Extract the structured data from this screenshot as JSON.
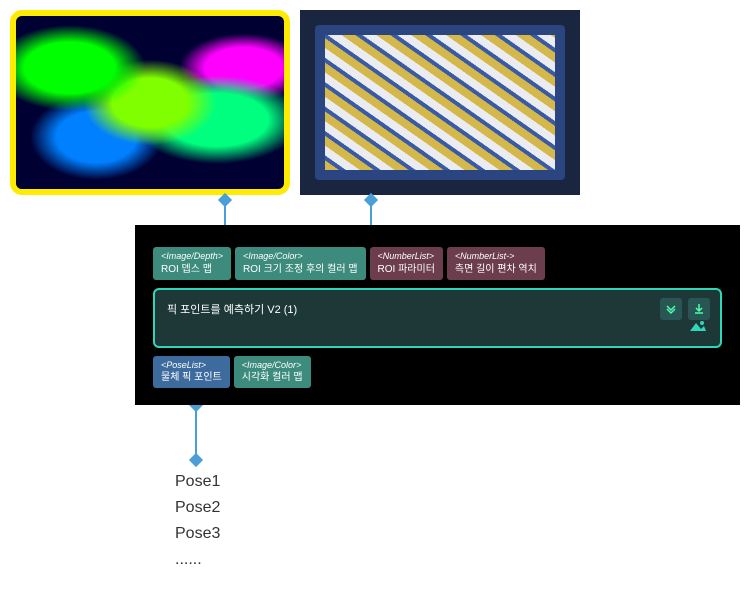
{
  "images": {
    "depth_alt": "ROI Depth Map",
    "color_alt": "ROI Color Map"
  },
  "node": {
    "title": "픽 포인트를 예측하기 V2 (1)",
    "input_ports": [
      {
        "type": "<Image/Depth>",
        "label": "ROI 뎁스 맵",
        "style": "teal"
      },
      {
        "type": "<Image/Color>",
        "label": "ROI 크기 조정 후의 컬러 맵",
        "style": "teal"
      },
      {
        "type": "<NumberList>",
        "label": "ROI 파라미터",
        "style": "maroon"
      },
      {
        "type": "<NumberList->",
        "label": "측면 길이 편차 역치",
        "style": "maroon"
      }
    ],
    "output_ports": [
      {
        "type": "<PoseList>",
        "label": "물체 픽 포인트",
        "style": "blue"
      },
      {
        "type": "<Image/Color>",
        "label": "시각화 컬러 맵",
        "style": "teal"
      }
    ]
  },
  "pose_output": {
    "items": [
      "Pose1",
      "Pose2",
      "Pose3",
      "......"
    ]
  }
}
